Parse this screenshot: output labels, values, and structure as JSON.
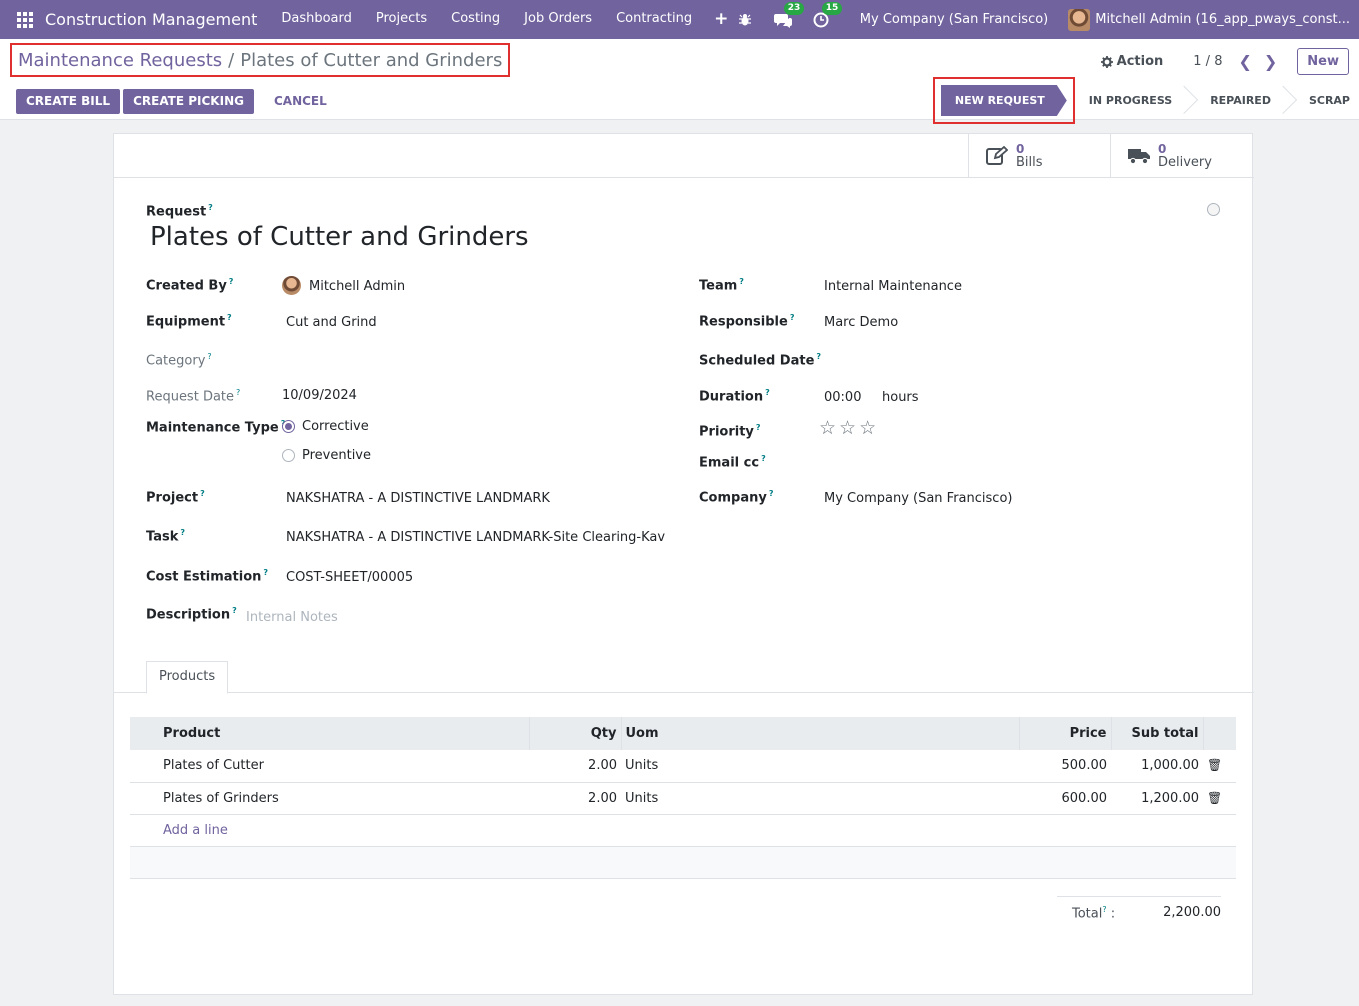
{
  "navbar": {
    "app_name": "Construction Management",
    "menu": [
      "Dashboard",
      "Projects",
      "Costing",
      "Job Orders",
      "Contracting"
    ],
    "plus": "+",
    "messages_badge": "23",
    "activities_badge": "15",
    "company": "My Company (San Francisco)",
    "user": "Mitchell Admin (16_app_pways_const..."
  },
  "breadcrumb": {
    "parent": "Maintenance Requests",
    "separator": "/",
    "current": "Plates of Cutter and Grinders"
  },
  "control": {
    "action_label": "Action",
    "pager": "1 / 8",
    "new_label": "New"
  },
  "buttons": {
    "create_bill": "CREATE BILL",
    "create_picking": "CREATE PICKING",
    "cancel": "CANCEL"
  },
  "stages": [
    "NEW REQUEST",
    "IN PROGRESS",
    "REPAIRED",
    "SCRAP"
  ],
  "active_stage": "NEW REQUEST",
  "smart_buttons": {
    "bills": {
      "value": "0",
      "label": "Bills"
    },
    "delivery": {
      "value": "0",
      "label": "Delivery"
    }
  },
  "form": {
    "request_label": "Request",
    "request_name": "Plates of Cutter and Grinders",
    "created_by_label": "Created By",
    "created_by": "Mitchell Admin",
    "equipment_label": "Equipment",
    "equipment": "Cut and Grind",
    "category_label": "Category",
    "request_date_label": "Request Date",
    "request_date": "10/09/2024",
    "maintenance_type_label": "Maintenance Type",
    "maintenance_type_options": [
      "Corrective",
      "Preventive"
    ],
    "maintenance_type_selected": "Corrective",
    "project_label": "Project",
    "project": "NAKSHATRA - A DISTINCTIVE LANDMARK",
    "task_label": "Task",
    "task": "NAKSHATRA - A DISTINCTIVE LANDMARK-Site Clearing-Kav",
    "cost_estimation_label": "Cost Estimation",
    "cost_estimation": "COST-SHEET/00005",
    "description_label": "Description",
    "description_placeholder": "Internal Notes",
    "team_label": "Team",
    "team": "Internal Maintenance",
    "responsible_label": "Responsible",
    "responsible": "Marc Demo",
    "scheduled_date_label": "Scheduled Date",
    "duration_label": "Duration",
    "duration": "00:00",
    "duration_unit": "hours",
    "priority_label": "Priority",
    "priority_value": 0,
    "priority_max": 3,
    "email_cc_label": "Email cc",
    "company_label": "Company",
    "company": "My Company (San Francisco)",
    "help_mark": "?"
  },
  "tabs": [
    "Products"
  ],
  "lines": {
    "headers": {
      "product": "Product",
      "qty": "Qty",
      "uom": "Uom",
      "price": "Price",
      "subtotal": "Sub total"
    },
    "rows": [
      {
        "product": "Plates of Cutter",
        "qty": "2.00",
        "uom": "Units",
        "price": "500.00",
        "subtotal": "1,000.00"
      },
      {
        "product": "Plates of Grinders",
        "qty": "2.00",
        "uom": "Units",
        "price": "600.00",
        "subtotal": "1,200.00"
      }
    ],
    "add_line": "Add a line"
  },
  "totals": {
    "label": "Total",
    "colon": ":",
    "value": "2,200.00"
  },
  "colors": {
    "brand": "#71639e",
    "highlight": "#e02f2f",
    "badge": "#28a745"
  }
}
